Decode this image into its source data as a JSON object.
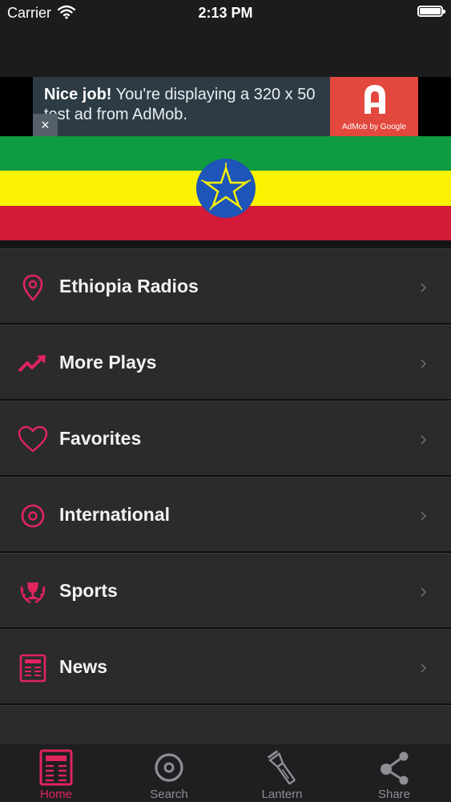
{
  "status_bar": {
    "carrier": "Carrier",
    "time": "2:13 PM"
  },
  "ad": {
    "headline": "Nice job!",
    "body": " You're displaying a 320 x 50 test ad from AdMob.",
    "close_symbol": "×",
    "logo_caption": "AdMob by Google",
    "logo_color": "#e2483d"
  },
  "flag": {
    "colors": [
      "#0f9b3f",
      "#f9f200",
      "#d31a38"
    ],
    "emblem": "ethiopia-emblem-icon"
  },
  "accent_color": "#e0245e",
  "menu": {
    "items": [
      {
        "label": "Ethiopia Radios",
        "icon": "location-pin-icon"
      },
      {
        "label": "More Plays",
        "icon": "trending-up-icon"
      },
      {
        "label": "Favorites",
        "icon": "heart-icon"
      },
      {
        "label": "International",
        "icon": "target-icon"
      },
      {
        "label": "Sports",
        "icon": "trophy-icon"
      },
      {
        "label": "News",
        "icon": "newspaper-icon"
      }
    ]
  },
  "tabbar": {
    "tabs": [
      {
        "label": "Home",
        "icon": "newspaper-icon",
        "active": true
      },
      {
        "label": "Search",
        "icon": "target-icon",
        "active": false
      },
      {
        "label": "Lantern",
        "icon": "flashlight-icon",
        "active": false
      },
      {
        "label": "Share",
        "icon": "share-icon",
        "active": false
      }
    ]
  }
}
